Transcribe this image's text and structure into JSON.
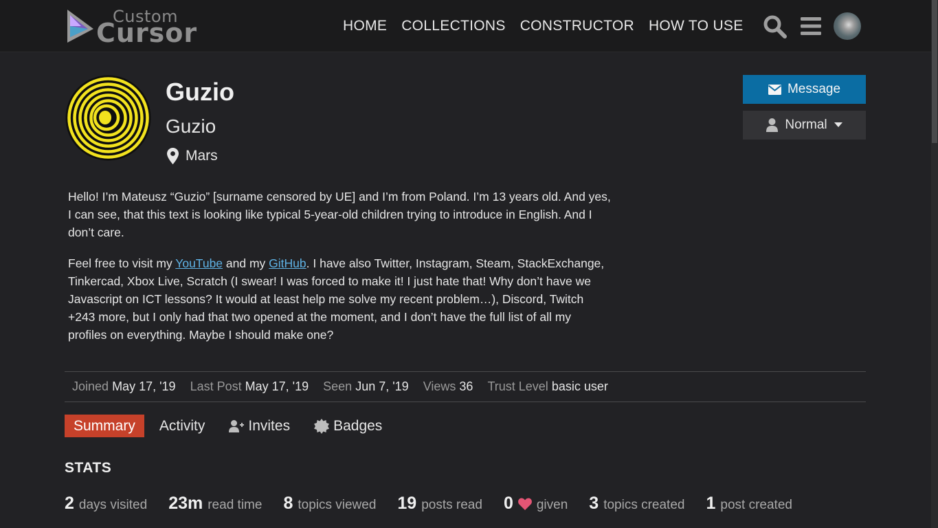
{
  "header": {
    "logo_top": "Custom",
    "logo_main": "Cursor",
    "nav": [
      "HOME",
      "COLLECTIONS",
      "CONSTRUCTOR",
      "HOW TO USE"
    ]
  },
  "profile": {
    "username": "Guzio",
    "full_name": "Guzio",
    "location": "Mars",
    "message_label": "Message",
    "notification_label": "Normal"
  },
  "bio": {
    "p1": "Hello! I’m Mateusz “Guzio” [surname censored by UE] and I’m from Poland. I’m 13 years old. And yes, I can see, that this text is looking like typical 5-year-old children trying to introduce in English. And I don’t care.",
    "p2_before": "Feel free to visit my ",
    "youtube": "YouTube",
    "p2_mid": " and my ",
    "github": "GitHub",
    "p2_after": ". I have also Twitter, Instagram, Steam, StackExchange, Tinkercad, Xbox Live, Scratch (I swear! I was forced to make it! I just hate that! Why don’t have we Javascript on ICT lessons? It would at least help me solve my recent problem…), Discord, Twitch +243 more, but I only had that two opened at the moment, and I don’t have the full list of all my profiles on everything. Maybe I should make one?"
  },
  "meta": {
    "joined_label": "Joined",
    "joined": "May 17, '19",
    "last_post_label": "Last Post",
    "last_post": "May 17, '19",
    "seen_label": "Seen",
    "seen": "Jun 7, '19",
    "views_label": "Views",
    "views": "36",
    "trust_label": "Trust Level",
    "trust": "basic user"
  },
  "tabs": {
    "summary": "Summary",
    "activity": "Activity",
    "invites": "Invites",
    "badges": "Badges"
  },
  "stats": {
    "title": "STATS",
    "items": [
      {
        "num": "2",
        "label": "days visited"
      },
      {
        "num": "23m",
        "label": "read time"
      },
      {
        "num": "8",
        "label": "topics viewed"
      },
      {
        "num": "19",
        "label": "posts read"
      },
      {
        "num": "0",
        "label": "given"
      },
      {
        "num": "3",
        "label": "topics created"
      },
      {
        "num": "1",
        "label": "post created"
      }
    ]
  },
  "colors": {
    "accent": "#c6412a",
    "primary_button": "#0b6da3",
    "link": "#5fb3e6",
    "heart": "#e45575"
  }
}
